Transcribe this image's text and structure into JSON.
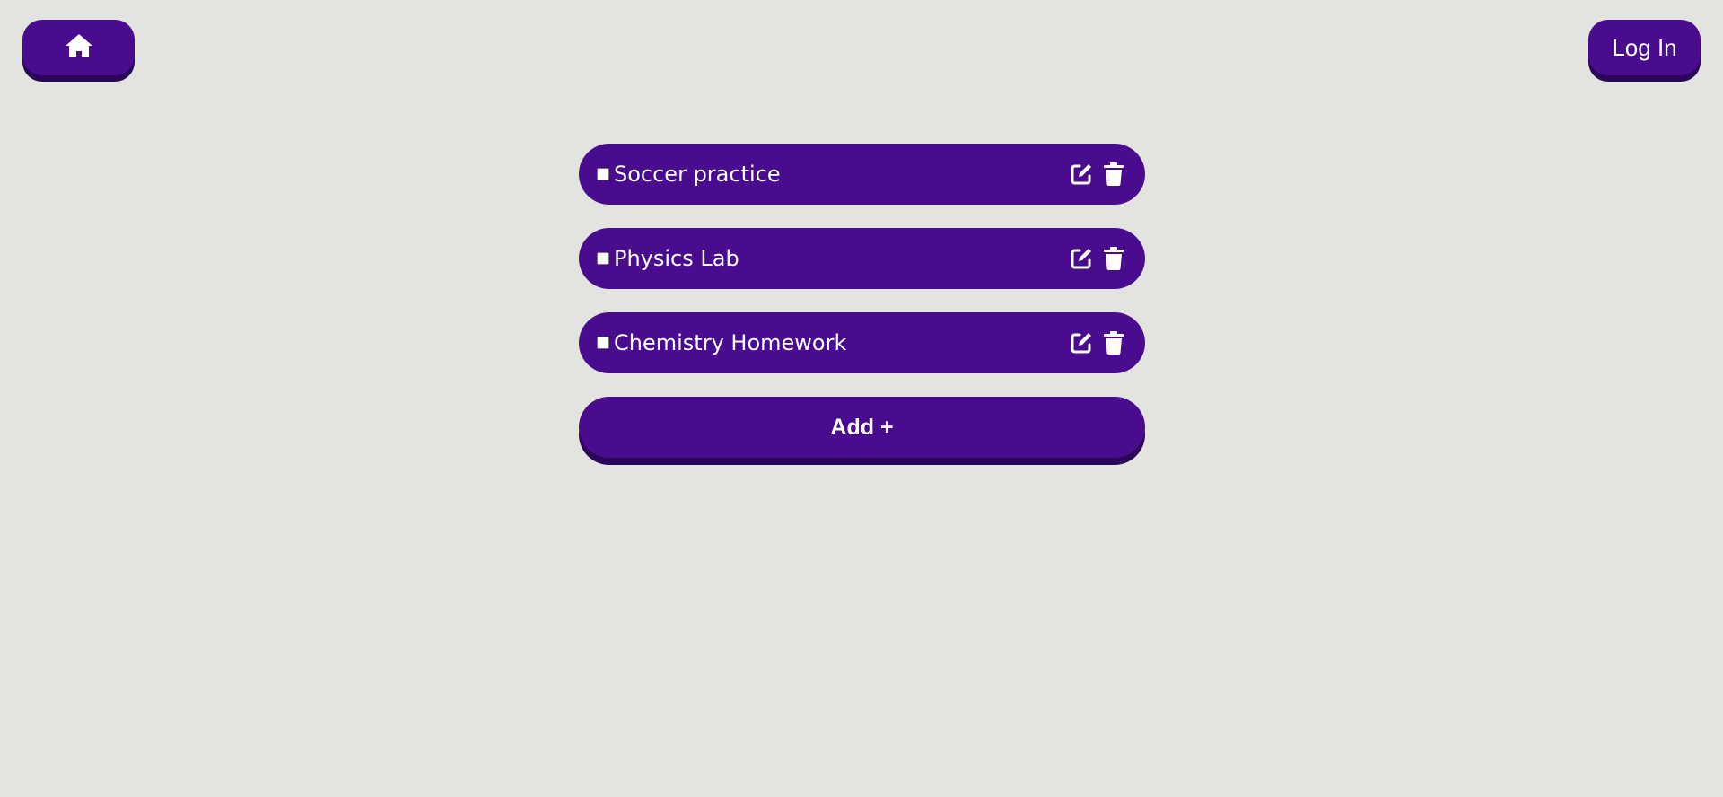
{
  "header": {
    "home_icon": "home-icon",
    "login_label": "Log In"
  },
  "todos": [
    {
      "label": "Soccer practice",
      "checked": false
    },
    {
      "label": "Physics Lab",
      "checked": false
    },
    {
      "label": "Chemistry Homework",
      "checked": false
    }
  ],
  "add_button": {
    "label": "Add +"
  },
  "icons": {
    "edit": "edit-icon",
    "delete": "trash-icon"
  },
  "colors": {
    "background": "#e3e3e0",
    "accent": "#490c8e",
    "accent_shadow": "#2b0657",
    "text": "#ffffff"
  }
}
